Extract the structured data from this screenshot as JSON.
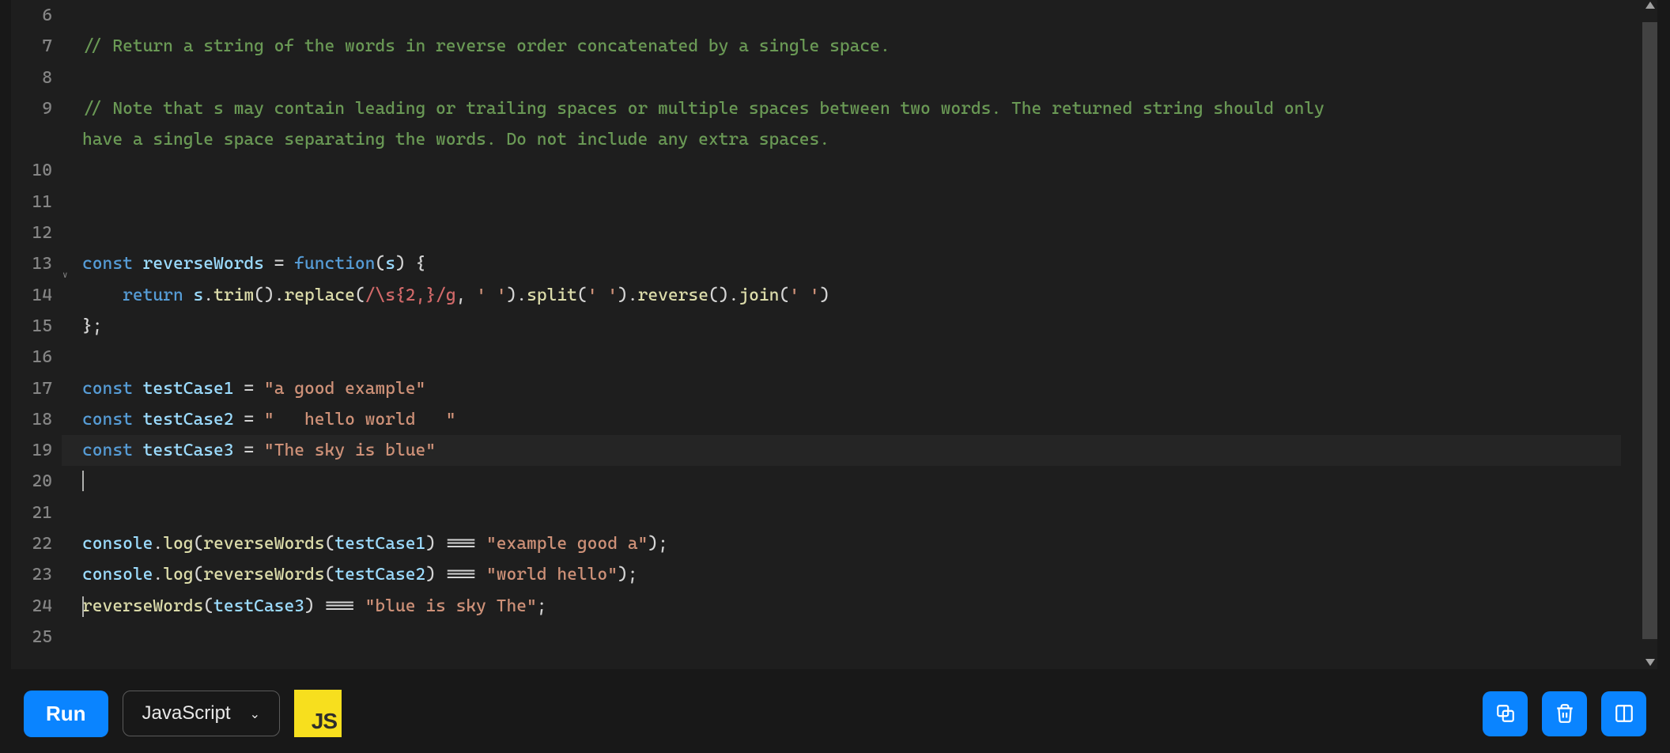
{
  "editor": {
    "gutterStart": 6,
    "gutterEnd": 25,
    "activeLine": 19,
    "foldableLines": [
      13
    ],
    "lines": {
      "6": [],
      "7": [
        {
          "t": "cmt",
          "v": "// Return a string of the words in reverse order concatenated by a single space."
        }
      ],
      "8": [],
      "9": [
        {
          "t": "cmt",
          "v": "// Note that s may contain leading or trailing spaces or multiple spaces between two words. The returned string should only"
        }
      ],
      "9b": [
        {
          "t": "cmt",
          "v": "have a single space separating the words. Do not include any extra spaces."
        }
      ],
      "10": [],
      "11": [],
      "12": [],
      "13": [
        {
          "t": "kw",
          "v": "const"
        },
        {
          "t": "pn",
          "v": " "
        },
        {
          "t": "var",
          "v": "reverseWords"
        },
        {
          "t": "pn",
          "v": " = "
        },
        {
          "t": "kw",
          "v": "function"
        },
        {
          "t": "pn",
          "v": "("
        },
        {
          "t": "var",
          "v": "s"
        },
        {
          "t": "pn",
          "v": ") {"
        }
      ],
      "14": [
        {
          "t": "pn",
          "v": "    "
        },
        {
          "t": "kw",
          "v": "return"
        },
        {
          "t": "pn",
          "v": " "
        },
        {
          "t": "var",
          "v": "s"
        },
        {
          "t": "pn",
          "v": "."
        },
        {
          "t": "fn",
          "v": "trim"
        },
        {
          "t": "pn",
          "v": "()."
        },
        {
          "t": "fn",
          "v": "replace"
        },
        {
          "t": "pn",
          "v": "("
        },
        {
          "t": "re",
          "v": "/\\s{2,}/g"
        },
        {
          "t": "pn",
          "v": ", "
        },
        {
          "t": "str",
          "v": "' '"
        },
        {
          "t": "pn",
          "v": ")."
        },
        {
          "t": "fn",
          "v": "split"
        },
        {
          "t": "pn",
          "v": "("
        },
        {
          "t": "str",
          "v": "' '"
        },
        {
          "t": "pn",
          "v": ")."
        },
        {
          "t": "fn",
          "v": "reverse"
        },
        {
          "t": "pn",
          "v": "()."
        },
        {
          "t": "fn",
          "v": "join"
        },
        {
          "t": "pn",
          "v": "("
        },
        {
          "t": "str",
          "v": "' '"
        },
        {
          "t": "pn",
          "v": ")"
        }
      ],
      "15": [
        {
          "t": "pn",
          "v": "};"
        }
      ],
      "16": [],
      "17": [
        {
          "t": "kw",
          "v": "const"
        },
        {
          "t": "pn",
          "v": " "
        },
        {
          "t": "var",
          "v": "testCase1"
        },
        {
          "t": "pn",
          "v": " = "
        },
        {
          "t": "str",
          "v": "\"a good example\""
        }
      ],
      "18": [
        {
          "t": "kw",
          "v": "const"
        },
        {
          "t": "pn",
          "v": " "
        },
        {
          "t": "var",
          "v": "testCase2"
        },
        {
          "t": "pn",
          "v": " = "
        },
        {
          "t": "str",
          "v": "\"   hello world   \""
        }
      ],
      "19": [
        {
          "t": "kw",
          "v": "const"
        },
        {
          "t": "pn",
          "v": " "
        },
        {
          "t": "var",
          "v": "testCase3"
        },
        {
          "t": "pn",
          "v": " = "
        },
        {
          "t": "str",
          "v": "\"The sky is blue\""
        }
      ],
      "20": [],
      "21": [],
      "22": [
        {
          "t": "var",
          "v": "console"
        },
        {
          "t": "pn",
          "v": "."
        },
        {
          "t": "fn",
          "v": "log"
        },
        {
          "t": "pn",
          "v": "("
        },
        {
          "t": "fn",
          "v": "reverseWords"
        },
        {
          "t": "pn",
          "v": "("
        },
        {
          "t": "var",
          "v": "testCase1"
        },
        {
          "t": "pn",
          "v": ") === "
        },
        {
          "t": "str",
          "v": "\"example good a\""
        },
        {
          "t": "pn",
          "v": ");"
        }
      ],
      "23": [
        {
          "t": "var",
          "v": "console"
        },
        {
          "t": "pn",
          "v": "."
        },
        {
          "t": "fn",
          "v": "log"
        },
        {
          "t": "pn",
          "v": "("
        },
        {
          "t": "fn",
          "v": "reverseWords"
        },
        {
          "t": "pn",
          "v": "("
        },
        {
          "t": "var",
          "v": "testCase2"
        },
        {
          "t": "pn",
          "v": ") === "
        },
        {
          "t": "str",
          "v": "\"world hello\""
        },
        {
          "t": "pn",
          "v": ");"
        }
      ],
      "24": [
        {
          "t": "fn",
          "v": "reverseWords"
        },
        {
          "t": "pn",
          "v": "("
        },
        {
          "t": "var",
          "v": "testCase3"
        },
        {
          "t": "pn",
          "v": ") === "
        },
        {
          "t": "str",
          "v": "\"blue is sky The\""
        },
        {
          "t": "pn",
          "v": ";"
        }
      ],
      "25": []
    }
  },
  "toolbar": {
    "run_label": "Run",
    "language": "JavaScript",
    "js_badge": "JS"
  }
}
